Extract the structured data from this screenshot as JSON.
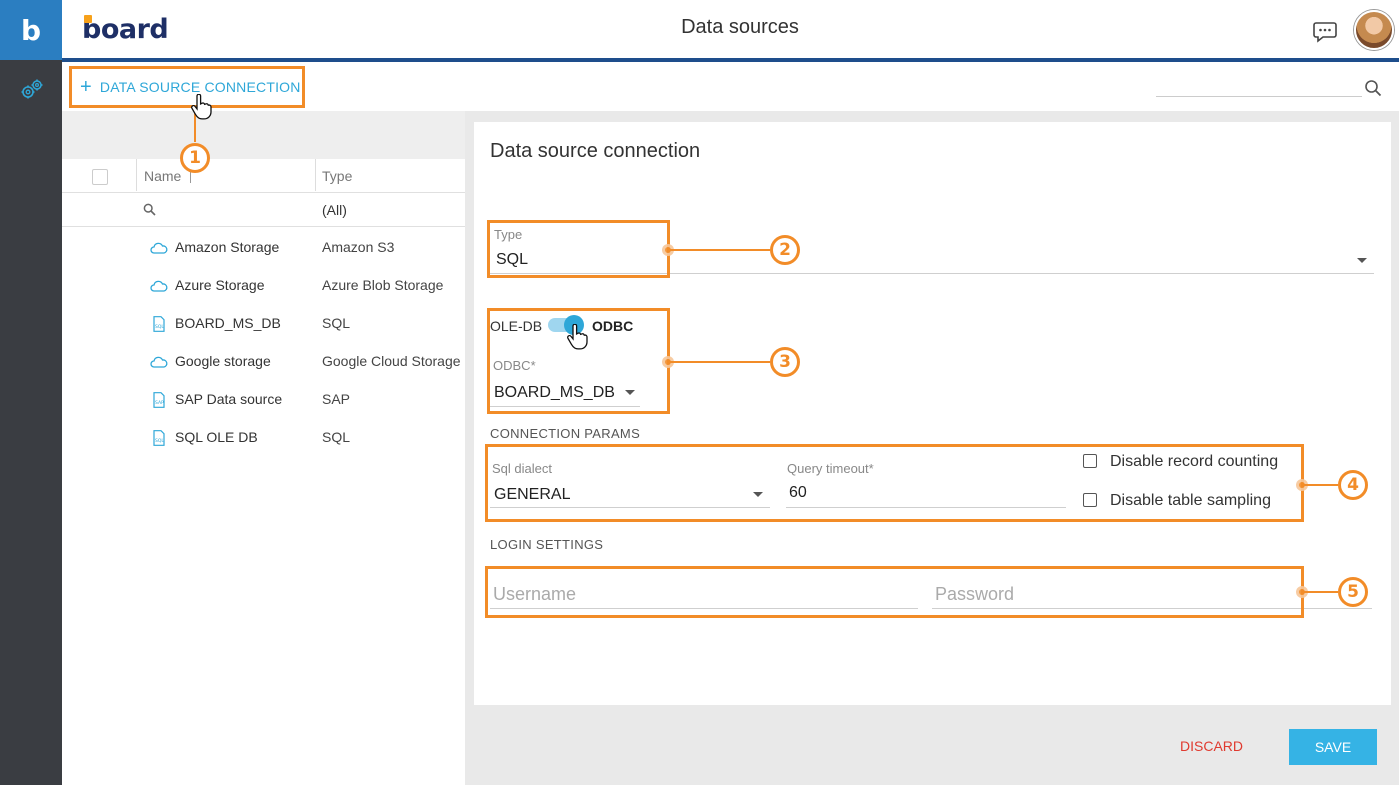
{
  "rail": {
    "logo_letter": "b"
  },
  "header": {
    "brand": "board",
    "title": "Data sources"
  },
  "toolbar": {
    "add_label": "DATA SOURCE CONNECTION",
    "search_placeholder": ""
  },
  "list": {
    "columns": {
      "name": "Name",
      "type": "Type"
    },
    "filter": {
      "type_value": "(All)"
    },
    "rows": [
      {
        "name": "Amazon Storage",
        "type": "Amazon S3",
        "icon": "cloud-icon"
      },
      {
        "name": "Azure Storage",
        "type": "Azure Blob Storage",
        "icon": "cloud-icon"
      },
      {
        "name": "BOARD_MS_DB",
        "type": "SQL",
        "icon": "sql-file-icon"
      },
      {
        "name": "Google storage",
        "type": "Google Cloud Storage",
        "icon": "cloud-icon"
      },
      {
        "name": "SAP Data source",
        "type": "SAP",
        "icon": "sap-file-icon"
      },
      {
        "name": "SQL OLE DB",
        "type": "SQL",
        "icon": "sql-file-icon"
      }
    ]
  },
  "form": {
    "title": "Data source connection",
    "type": {
      "label": "Type",
      "value": "SQL"
    },
    "toggle": {
      "left_label": "OLE-DB",
      "right_label": "ODBC",
      "selected": "ODBC"
    },
    "odbc": {
      "label": "ODBC",
      "required_mark": "*",
      "value": "BOARD_MS_DB"
    },
    "connection_params": {
      "section_label": "CONNECTION PARAMS",
      "sql_dialect": {
        "label": "Sql dialect",
        "value": "GENERAL"
      },
      "query_timeout": {
        "label": "Query timeout",
        "required_mark": "*",
        "value": "60"
      },
      "disable_record_counting": {
        "label": "Disable record counting",
        "checked": false
      },
      "disable_table_sampling": {
        "label": "Disable table sampling",
        "checked": false
      }
    },
    "login_settings": {
      "section_label": "LOGIN SETTINGS",
      "username_placeholder": "Username",
      "password_placeholder": "Password"
    }
  },
  "actions": {
    "discard": "DISCARD",
    "save": "SAVE"
  },
  "callouts": [
    "1",
    "2",
    "3",
    "4",
    "5"
  ],
  "colors": {
    "accent": "#2ea7d8",
    "callout": "#f28c28",
    "discard": "#e03a2f",
    "header_line": "#1e4e8c"
  }
}
